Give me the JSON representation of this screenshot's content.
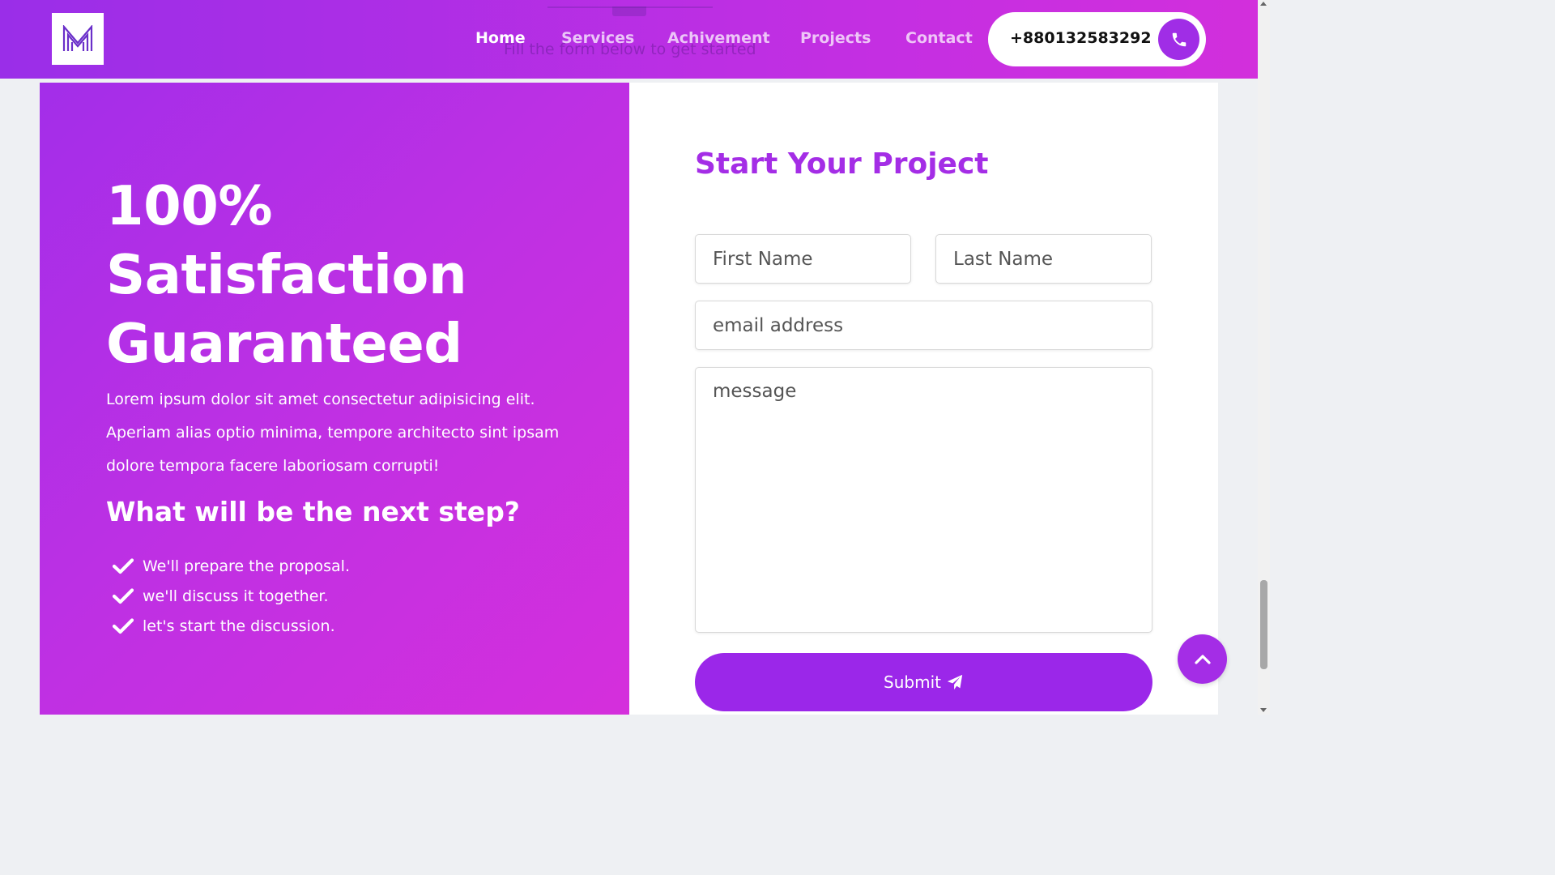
{
  "navbar": {
    "items": [
      {
        "label": "Home",
        "active": true
      },
      {
        "label": "Services",
        "active": false
      },
      {
        "label": "Achivement",
        "active": false
      },
      {
        "label": "Projects",
        "active": false
      },
      {
        "label": "Contact",
        "active": false
      }
    ],
    "phone": "+880132583292",
    "phone_icon": "phone-icon",
    "logo_icon": "logo-m-icon"
  },
  "background_section": {
    "subtitle": "Fill the form below to get started"
  },
  "hero": {
    "title_line1": "100%",
    "title_line2": "Satisfaction",
    "title_line3": "Guaranteed",
    "description": "Lorem ipsum dolor sit amet consectetur adipisicing elit. Aperiam alias optio minima, tempore architecto sint ipsam dolore tempora facere laboriosam corrupti!",
    "next_step_title": "What will be the next step?",
    "steps": [
      "We'll prepare the proposal.",
      "we'll discuss it together.",
      "let's start the discussion."
    ]
  },
  "form": {
    "title": "Start Your Project",
    "first_name_placeholder": "First Name",
    "last_name_placeholder": "Last Name",
    "email_placeholder": "email address",
    "message_placeholder": "message",
    "submit_label": "Submit",
    "submit_icon": "paper-plane-icon"
  },
  "scroll_top_icon": "chevron-up-icon",
  "colors": {
    "brand": "#a42de6",
    "gradient_start": "#9a2ee8",
    "gradient_end": "#d22fdc",
    "submit": "#9b27e9"
  }
}
